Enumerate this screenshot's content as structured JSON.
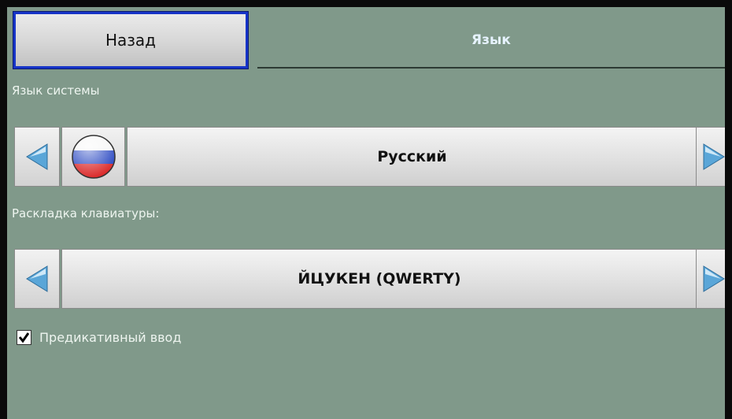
{
  "header": {
    "back_label": "Назад",
    "title": "Язык"
  },
  "system_language": {
    "label": "Язык системы",
    "value": "Русский",
    "flag_icon": "russia-flag-icon",
    "flag_colors": [
      "#ffffff",
      "#1f3fbf",
      "#d92020"
    ]
  },
  "keyboard_layout": {
    "label": "Раскладка клавиатуры:",
    "value": "ЙЦУКЕН (QWERTY)"
  },
  "predictive_input": {
    "label": "Предикативный ввод",
    "checked": true
  },
  "colors": {
    "background": "#80998a",
    "focus_border": "#1634c8",
    "arrow_fill": "#5aa6d8"
  }
}
